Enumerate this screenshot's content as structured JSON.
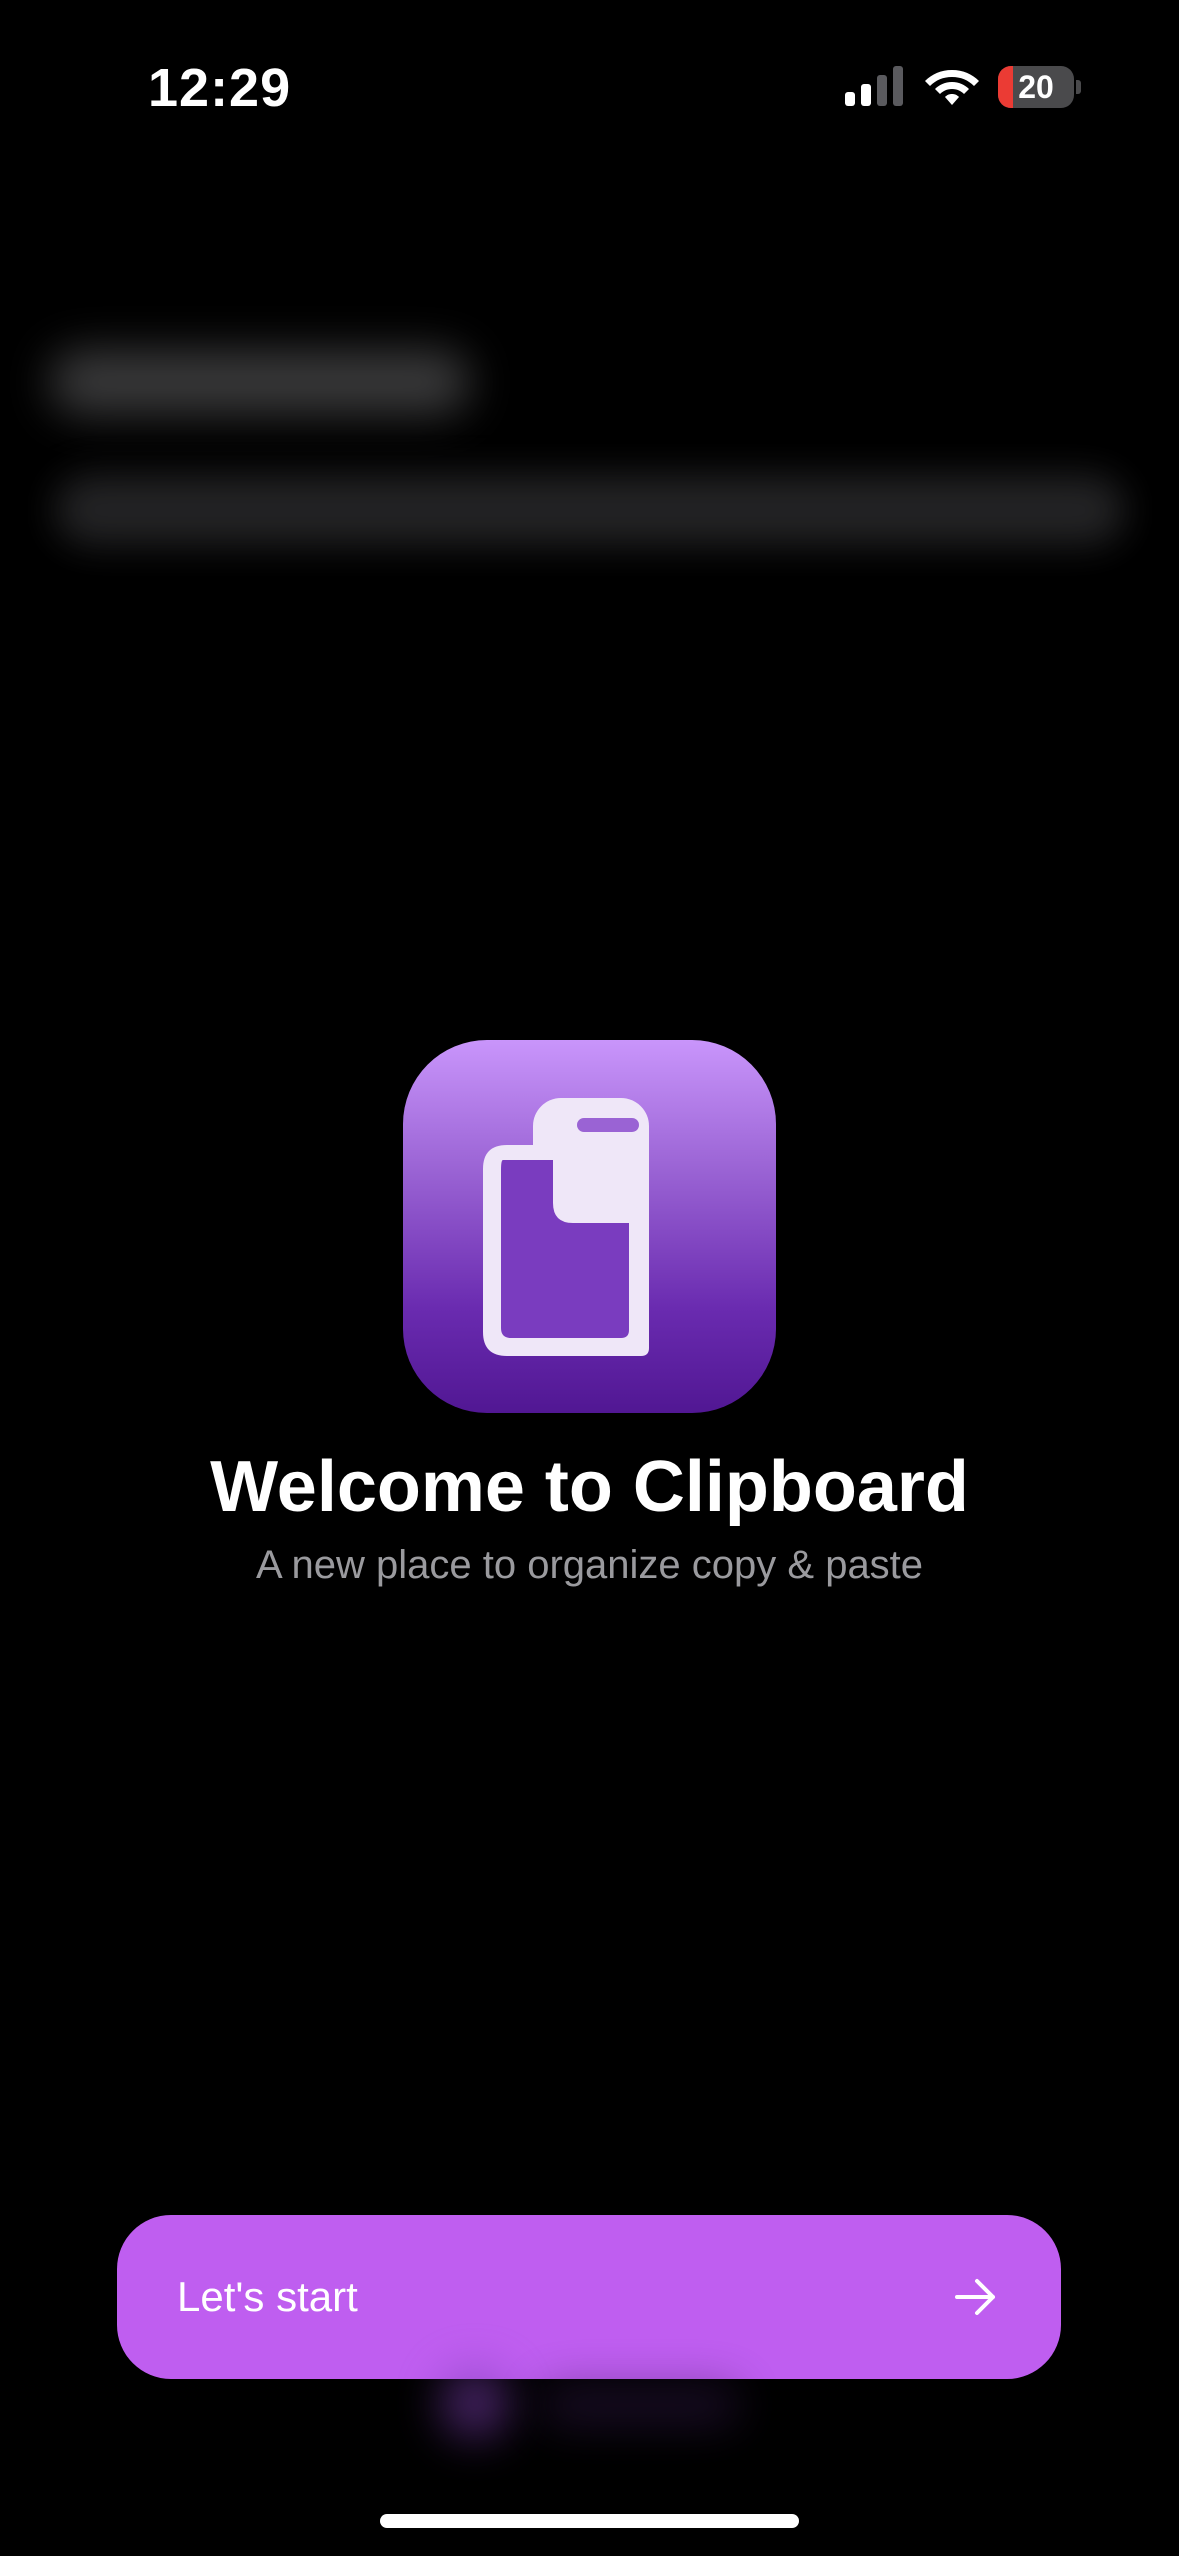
{
  "status_bar": {
    "time": "12:29",
    "signal_icon": "cellular-signal-icon",
    "signal_bars_active": 2,
    "signal_bars_total": 4,
    "wifi_icon": "wifi-icon",
    "battery_icon": "battery-icon",
    "battery_level": "20",
    "battery_fraction": 0.2,
    "battery_low_color": "#eb3b34"
  },
  "welcome": {
    "app_icon": "clipboard-app-icon",
    "title": "Welcome to Clipboard",
    "subtitle": "A new place to organize copy & paste"
  },
  "actions": {
    "start_label": "Let's start",
    "start_icon": "arrow-right-icon",
    "accent_color": "#bf5ef0"
  }
}
